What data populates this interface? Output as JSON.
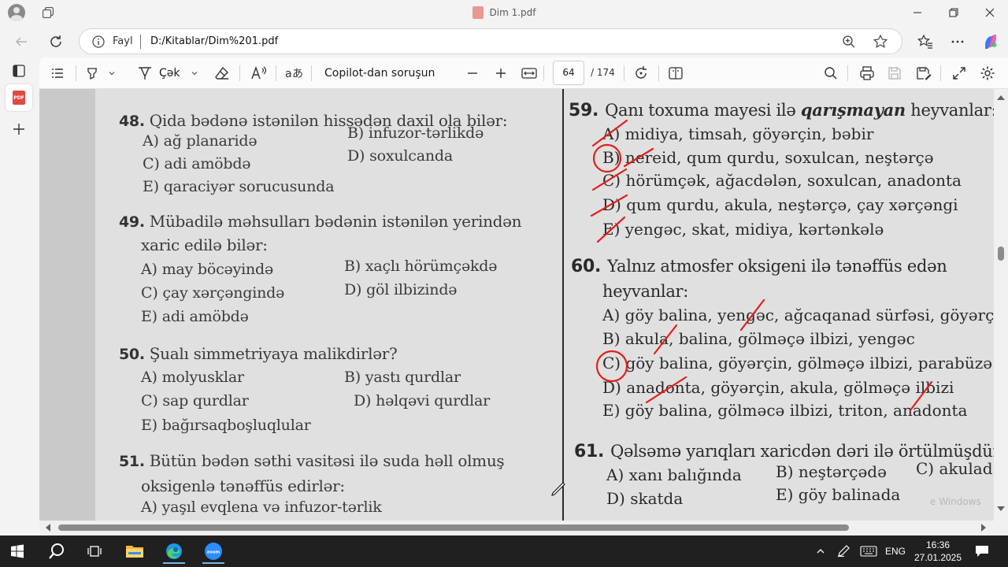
{
  "window": {
    "title": "Dim 1.pdf"
  },
  "address_bar": {
    "scheme_label": "Fayl",
    "url": "D:/Kitablar/Dim%201.pdf"
  },
  "pdf_toolbar": {
    "draw_label": "Çək",
    "copilot_label": "Copilot-dan soruşun",
    "current_page": "64",
    "total_pages": "/ 174"
  },
  "document": {
    "left_column": [
      {
        "number": "48.",
        "question": "Qida bədənə istənilən hissədən daxil ola bilər:",
        "options": {
          "a": "A) ağ planaridə",
          "b": "B) infuzor-tərlikdə",
          "c": "C) adi amöbdə",
          "d": "D) soxulcanda",
          "e": "E) qaraciyər sorucusunda"
        }
      },
      {
        "number": "49.",
        "question_line1": "Mübadilə məhsulları bədənin istənilən yerindən",
        "question_line2": "xaric edilə bilər:",
        "options": {
          "a": "A) may böcəyində",
          "b": "B) xaçlı hörümçəkdə",
          "c": "C) çay xərçəngində",
          "d": "D) göl ilbizində",
          "e": "E) adi amöbdə"
        }
      },
      {
        "number": "50.",
        "question": "Şualı simmetriyaya malikdirlər?",
        "options": {
          "a": "A) molyusklar",
          "b": "B) yastı qurdlar",
          "c": "C) sap qurdlar",
          "d": "D) həlqəvi qurdlar",
          "e": "E) bağırsaqboşluqlular"
        }
      },
      {
        "number": "51.",
        "question_line1": "Bütün bədən səthi vasitəsi ilə suda həll olmuş",
        "question_line2": "oksigenlə tənəffüs edirlər:",
        "options": {
          "a": "A) yaşıl evqlena və infuzor-tərlik"
        }
      }
    ],
    "right_column": [
      {
        "number": "59.",
        "question_pre": "Qanı toxuma mayesi ilə",
        "question_keyword": "qarışmayan",
        "question_post": "heyvanlar:",
        "options": {
          "a": "A) midiya, timsah, göyərçin, bəbir",
          "b": "B) nereid, qum qurdu, soxulcan, neştərçə",
          "c": "C) hörümçək, ağacdələn, soxulcan, anadonta",
          "d": "D) qum qurdu, akula, neştərçə, çay xərçəngi",
          "e": "E) yengəc, skat, midiya, kərtənkələ"
        }
      },
      {
        "number": "60.",
        "question_line1": "Yalnız atmosfer oksigeni ilə tənəffüs edən",
        "question_line2": "heyvanlar:",
        "options": {
          "a": "A) göy balina, yengəc, ağcaqanad sürfəsi, göyərçi",
          "b": "B) akula, balina, gölməçə ilbizi, yengəc",
          "c": "C) göy balina, göyərçin, gölməçə ilbizi, parabüzə",
          "d": "D) anadonta, göyərçin, akula, gölməçə ilbizi",
          "e": "E) göy balina, gölməcə ilbizi, triton, anadonta"
        }
      },
      {
        "number": "61.",
        "question": "Qəlsəmə yarıqları xaricdən dəri ilə örtülmüşdür:",
        "options": {
          "a": "A) xanı balığında",
          "b": "B) neştərçədə",
          "c": "C) akulad",
          "d": "D) skatda",
          "e": "E) göy balinada"
        }
      }
    ],
    "watermark": "e Windows"
  },
  "taskbar": {
    "language": "ENG",
    "time": "16:36",
    "date": "27.01.2025"
  },
  "colors": {
    "ink_red": "#e0201c",
    "taskbar_bg": "#202020",
    "chrome_bg": "#f3f3f3",
    "page_bg": "#e0e0e0"
  }
}
